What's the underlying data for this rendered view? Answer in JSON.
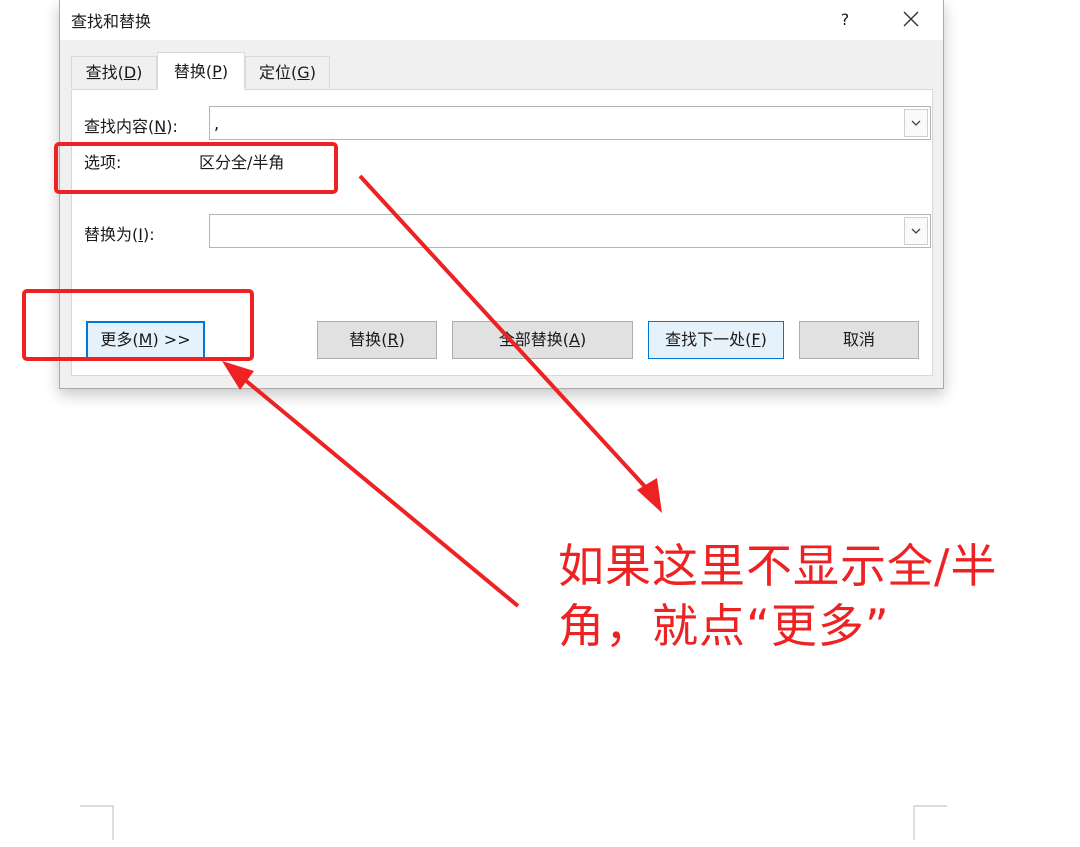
{
  "dialog": {
    "title": "查找和替换",
    "help_label": "?",
    "tabs": [
      {
        "label": "查找",
        "key": "D"
      },
      {
        "label": "替换",
        "key": "P"
      },
      {
        "label": "定位",
        "key": "G"
      }
    ],
    "active_tab": "替换",
    "find": {
      "label": "查找内容",
      "key": "N",
      "value": ","
    },
    "options": {
      "label": "选项:",
      "value": "区分全/半角"
    },
    "replace": {
      "label": "替换为",
      "key": "I",
      "value": ""
    },
    "buttons": {
      "more": {
        "label": "更多",
        "key": "M",
        "suffix": " >>"
      },
      "replace": {
        "label": "替换",
        "key": "R"
      },
      "replace_all": {
        "label": "全部替换",
        "key": "A"
      },
      "find_next": {
        "label": "查找下一处",
        "key": "F"
      },
      "cancel": {
        "label": "取消"
      }
    }
  },
  "annotation": {
    "line1": "如果这里不显示全/半",
    "line2": "角，就点“更多”",
    "color": "#ee2222"
  },
  "icons": [
    "close-icon",
    "dropdown-arrow-icon"
  ]
}
